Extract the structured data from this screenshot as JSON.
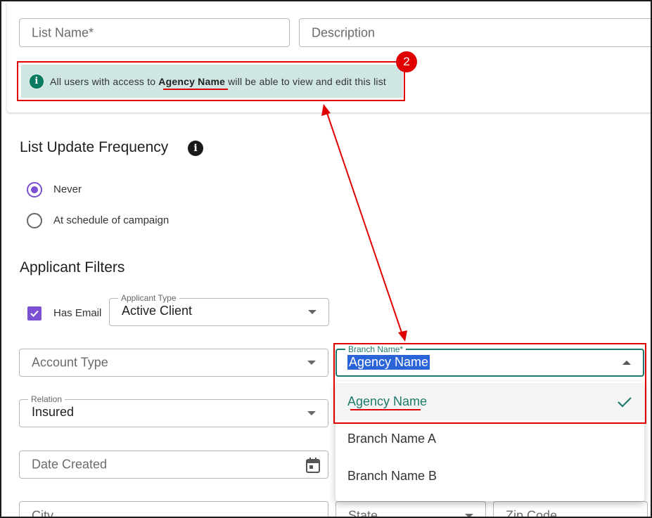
{
  "top": {
    "list_name_placeholder": "List Name*",
    "description_placeholder": "Description"
  },
  "banner": {
    "text_before": "All users with access to",
    "agency": "Agency Name",
    "text_after": "will be able to view and edit this list",
    "badge": "2",
    "icon_glyph": "i"
  },
  "update_frequency": {
    "title": "List Update Frequency",
    "help_glyph": "i",
    "options": [
      {
        "label": "Never",
        "checked": true
      },
      {
        "label": "At schedule of campaign",
        "checked": false
      }
    ]
  },
  "filters": {
    "title": "Applicant Filters",
    "has_email": "Has Email",
    "applicant_type_label": "Applicant Type",
    "applicant_type_value": "Active Client",
    "account_type_placeholder": "Account Type",
    "branch_label": "Branch Name*",
    "branch_value": "Agency Name",
    "relation_label": "Relation",
    "relation_value": "Insured",
    "date_created_placeholder": "Date Created",
    "city_placeholder": "City",
    "state_placeholder": "State",
    "zip_placeholder": "Zip Code"
  },
  "branch_dropdown": {
    "items": [
      "Agency Name",
      "Branch Name A",
      "Branch Name B"
    ],
    "selected": "Agency Name"
  },
  "colors": {
    "accent_purple": "#7a4fd1",
    "teal": "#0b7a63",
    "annotation_red": "#e00000",
    "banner_bg": "#cfe6e3"
  },
  "icons": [
    "info-icon",
    "help-icon",
    "calendar-icon",
    "check-icon",
    "chevron-down-icon",
    "chevron-up-icon"
  ]
}
